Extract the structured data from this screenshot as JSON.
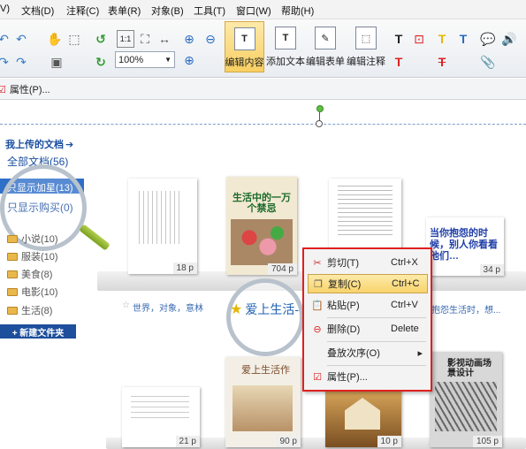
{
  "menubar": {
    "items": [
      "V)",
      "文档(D)",
      "注释(C)",
      "表单(R)",
      "对象(B)",
      "工具(T)",
      "窗口(W)",
      "帮助(H)"
    ]
  },
  "toolbar": {
    "zoom_value": "100%",
    "edit_content": "编辑内容",
    "add_text": "添加文本",
    "edit_form": "编辑表单",
    "edit_annotation": "编辑注释"
  },
  "propbar": {
    "properties_label": "属性(P)..."
  },
  "sidebar": {
    "my_docs_link": "我上传的文档",
    "filters": [
      "全部文档(56)",
      "只显示加星(13)",
      "只显示购买(0)"
    ],
    "categories": [
      "小说(10)",
      "服装(10)",
      "美食(8)",
      "电影(10)",
      "生活(8)"
    ],
    "new_folder_button": "+ 新建文件夹"
  },
  "books": {
    "row1_pages": [
      "18 p",
      "704 p",
      "34 p"
    ],
    "row2_pages": [
      "21 p",
      "90 p",
      "10 p",
      "105 p"
    ],
    "cover_texts": {
      "book2_title": "生活中的一万个禁忌",
      "book4_title": "当你抱怨的时候，别人你看看他们…",
      "book5_title": "爱上生活作",
      "book7_title": "影视动画场景设计"
    },
    "captions": [
      "世界，对象，意林",
      "爱上生活-",
      "抱怨生活时，想..."
    ]
  },
  "context_menu": {
    "items": [
      {
        "label": "剪切(T)",
        "shortcut": "Ctrl+X"
      },
      {
        "label": "复制(C)",
        "shortcut": "Ctrl+C"
      },
      {
        "label": "粘贴(P)",
        "shortcut": "Ctrl+V"
      },
      {
        "label": "删除(D)",
        "shortcut": "Delete"
      },
      {
        "label": "叠放次序(O)",
        "shortcut": ""
      },
      {
        "label": "属性(P)...",
        "shortcut": ""
      }
    ]
  },
  "colors": {
    "accent_blue": "#1a4fa0",
    "highlight_red": "#e02020",
    "selection_gold": "#f9cf62"
  }
}
